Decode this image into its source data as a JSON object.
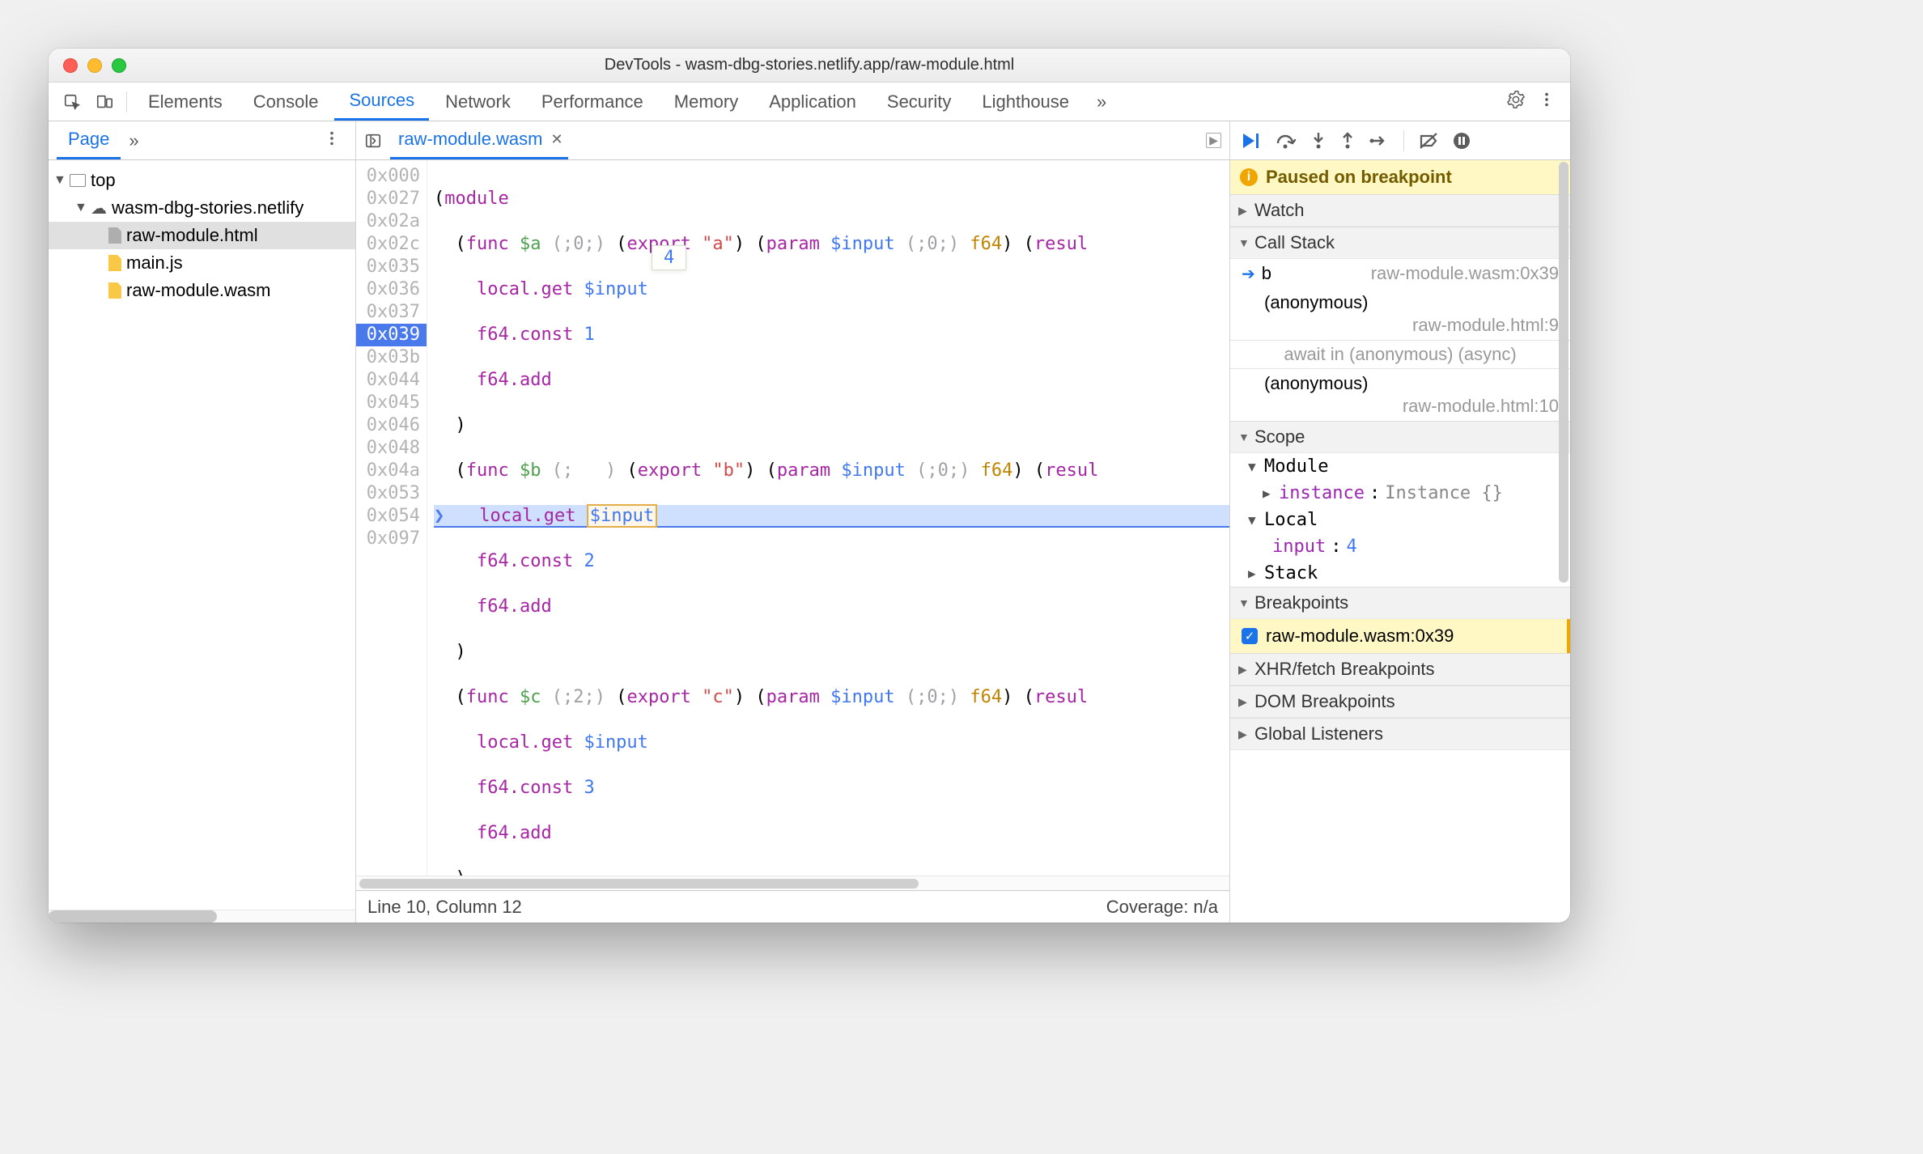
{
  "window": {
    "title": "DevTools - wasm-dbg-stories.netlify.app/raw-module.html"
  },
  "mainTabs": {
    "items": [
      "Elements",
      "Console",
      "Sources",
      "Network",
      "Performance",
      "Memory",
      "Application",
      "Security",
      "Lighthouse"
    ],
    "active": "Sources"
  },
  "navigator": {
    "activeTab": "Page",
    "tree": {
      "top": "top",
      "origin": "wasm-dbg-stories.netlify",
      "files": [
        "raw-module.html",
        "main.js",
        "raw-module.wasm"
      ]
    }
  },
  "editor": {
    "openFile": "raw-module.wasm",
    "hoverHint": "4",
    "gutter": [
      "0x000",
      "0x027",
      "0x02a",
      "0x02c",
      "0x035",
      "0x036",
      "0x037",
      "0x039",
      "0x03b",
      "0x044",
      "0x045",
      "0x046",
      "0x048",
      "0x04a",
      "0x053",
      "0x054",
      "0x097"
    ],
    "currentOffset": "0x039",
    "code": {
      "l1_a": "(",
      "l1_b": "module",
      "l2_a": "  (",
      "l2_b": "func",
      "l2_c": " $a ",
      "l2_d": "(;0;)",
      "l2_e": " (",
      "l2_f": "export",
      "l2_g": " \"a\"",
      "l2_h": ") (",
      "l2_i": "param",
      "l2_j": " $input ",
      "l2_k": "(;0;)",
      "l2_l": " f64",
      "l2_m": ") (",
      "l2_n": "resul",
      "l3_a": "    ",
      "l3_b": "local.get",
      "l3_c": " $input",
      "l4_a": "    ",
      "l4_b": "f64.const",
      "l4_c": " 1",
      "l5_a": "    ",
      "l5_b": "f64.add",
      "l6_a": "  )",
      "l7_a": "  (",
      "l7_b": "func",
      "l7_c": " $b ",
      "l7_d": "(;   )",
      "l7_e": " (",
      "l7_f": "export",
      "l7_g": " \"b\"",
      "l7_h": ") (",
      "l7_i": "param",
      "l7_j": " $input ",
      "l7_k": "(;0;)",
      "l7_l": " f64",
      "l7_m": ") (",
      "l7_n": "resul",
      "l8_a": "    ",
      "l8_b": "local.get",
      "l8_c": " ",
      "l8_d": "$input",
      "l9_a": "    ",
      "l9_b": "f64.const",
      "l9_c": " 2",
      "l10_a": "    ",
      "l10_b": "f64.add",
      "l11_a": "  )",
      "l12_a": "  (",
      "l12_b": "func",
      "l12_c": " $c ",
      "l12_d": "(;2;)",
      "l12_e": " (",
      "l12_f": "export",
      "l12_g": " \"c\"",
      "l12_h": ") (",
      "l12_i": "param",
      "l12_j": " $input ",
      "l12_k": "(;0;)",
      "l12_l": " f64",
      "l12_m": ") (",
      "l12_n": "resul",
      "l13_a": "    ",
      "l13_b": "local.get",
      "l13_c": " $input",
      "l14_a": "    ",
      "l14_b": "f64.const",
      "l14_c": " 3",
      "l15_a": "    ",
      "l15_b": "f64.add",
      "l16_a": "  )",
      "l17_a": ")"
    },
    "status": {
      "pos": "Line 10, Column 12",
      "coverage": "Coverage: n/a"
    }
  },
  "debugger": {
    "pauseMessage": "Paused on breakpoint",
    "sections": {
      "watch": "Watch",
      "callStack": "Call Stack",
      "scope": "Scope",
      "breakpoints": "Breakpoints",
      "xhr": "XHR/fetch Breakpoints",
      "dom": "DOM Breakpoints",
      "globalListeners": "Global Listeners"
    },
    "callStack": [
      {
        "fn": "b",
        "loc": "raw-module.wasm:0x39",
        "current": true
      },
      {
        "fn": "(anonymous)",
        "loc": "raw-module.html:9"
      },
      {
        "async": "await in (anonymous) (async)"
      },
      {
        "fn": "(anonymous)",
        "loc": "raw-module.html:10"
      }
    ],
    "scope": {
      "moduleLabel": "Module",
      "instanceKey": "instance",
      "instanceVal": "Instance {}",
      "localLabel": "Local",
      "localKey": "input",
      "localVal": "4",
      "stackLabel": "Stack"
    },
    "breakpoints": [
      {
        "label": "raw-module.wasm:0x39",
        "checked": true
      }
    ]
  }
}
